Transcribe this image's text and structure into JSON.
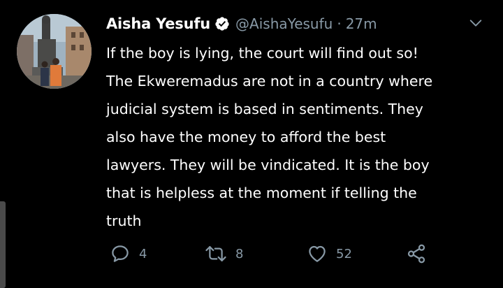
{
  "tweet": {
    "author": {
      "display_name": "Aisha Yesufu",
      "handle": "@AishaYesufu",
      "verified": true
    },
    "separator": "·",
    "timestamp": "27m",
    "text": "If the boy is lying, the court will find out so!\nThe Ekweremadus are not in a country where\njudicial system is based in sentiments. They\nalso have the money to afford the best\nlawyers. They will be vindicated. It is the boy\nthat is helpless at the moment if telling the\ntruth",
    "actions": {
      "reply_count": "4",
      "retweet_count": "8",
      "like_count": "52"
    }
  },
  "icons": {
    "verified": "verified-badge-icon",
    "menu": "chevron-down-icon",
    "reply": "reply-icon",
    "retweet": "retweet-icon",
    "like": "heart-icon",
    "share": "share-icon"
  },
  "colors": {
    "background": "#000000",
    "text_primary": "#ffffff",
    "text_secondary": "#8899a6"
  }
}
